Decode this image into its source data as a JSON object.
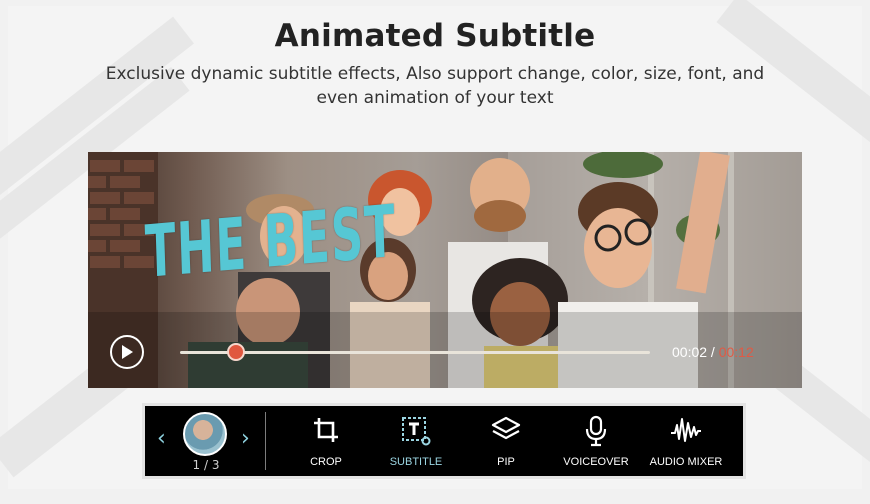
{
  "headline": "Animated Subtitle",
  "subline": "Exclusive dynamic subtitle effects, Also support change, color, size, font, and even animation of your text",
  "player": {
    "overlay_text": "THE BEST",
    "current_time": "00:02",
    "separator": " / ",
    "duration": "00:12",
    "progress_fraction": 0.12
  },
  "clip_nav": {
    "counter": "1 / 3",
    "prev_glyph": "‹",
    "next_glyph": "›"
  },
  "tools": [
    {
      "id": "crop",
      "label": "CROP",
      "icon": "crop-icon",
      "active": false
    },
    {
      "id": "subtitle",
      "label": "SUBTITLE",
      "icon": "subtitle-icon",
      "active": true
    },
    {
      "id": "pip",
      "label": "PIP",
      "icon": "layers-icon",
      "active": false
    },
    {
      "id": "voiceover",
      "label": "VOICEOVER",
      "icon": "microphone-icon",
      "active": false
    },
    {
      "id": "audio-mixer",
      "label": "AUDIO MIXER",
      "icon": "waveform-icon",
      "active": false
    }
  ],
  "colors": {
    "accent": "#9bd5e2",
    "progress": "#e0573f",
    "overlay_text": "#56c7d4",
    "duration": "#e05a45"
  }
}
